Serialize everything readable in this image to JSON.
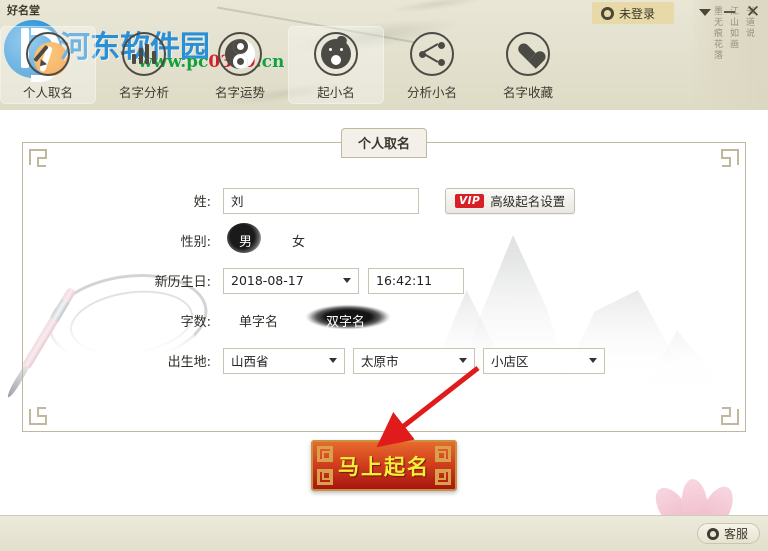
{
  "window": {
    "app_title": "好名堂",
    "login_label": "未登录",
    "login_icon": "user-avatar-icon",
    "menu_icon": "chevron-down-icon",
    "minimize_icon": "minimize-icon",
    "close_icon": "close-icon"
  },
  "watermark": {
    "brand": "河东软件园",
    "url_prefix": "www.pc",
    "url_mid": "0359",
    "url_suffix": ".cn",
    "logo_icon": "pc-logo-icon"
  },
  "calligraphy": {
    "col1": "墨无痕花落",
    "col2": "江山如画",
    "col3": "书道说"
  },
  "nav": {
    "items": [
      {
        "label": "个人取名",
        "icon": "pen-icon",
        "active": true
      },
      {
        "label": "名字分析",
        "icon": "bars-icon",
        "active": false
      },
      {
        "label": "名字运势",
        "icon": "yinyang-icon",
        "active": false
      },
      {
        "label": "起小名",
        "icon": "baby-icon",
        "active": true
      },
      {
        "label": "分析小名",
        "icon": "share-icon",
        "active": false
      },
      {
        "label": "名字收藏",
        "icon": "heart-icon",
        "active": false
      }
    ]
  },
  "panel": {
    "title": "个人取名",
    "rows": {
      "surname": {
        "label": "姓:",
        "value": "刘",
        "placeholder": ""
      },
      "gender": {
        "label": "性别:",
        "options": [
          "男",
          "女"
        ],
        "selected": "男"
      },
      "birthday": {
        "label": "新历生日:",
        "date_value": "2018-08-17",
        "time_value": "16:42:11"
      },
      "name_length": {
        "label": "字数:",
        "options": [
          "单字名",
          "双字名"
        ],
        "selected": "双字名"
      },
      "birthplace": {
        "label": "出生地:",
        "province": "山西省",
        "city": "太原市",
        "district": "小店区"
      }
    },
    "vip_button": {
      "badge": "VIP",
      "label": "高级起名设置"
    }
  },
  "submit": {
    "label": "马上起名"
  },
  "footer": {
    "support_label": "客服",
    "support_icon": "headset-icon"
  },
  "colors": {
    "header_bg": "#e4e1cf",
    "login_pill": "#e7d9a8",
    "panel_border": "#bfb89e",
    "vip_red": "#d81f26",
    "submit_gold_text": "#f5ee3a",
    "annotation_red": "#e01b1b",
    "brand_blue": "#2a8fd4",
    "brand_green": "#14a03c"
  }
}
